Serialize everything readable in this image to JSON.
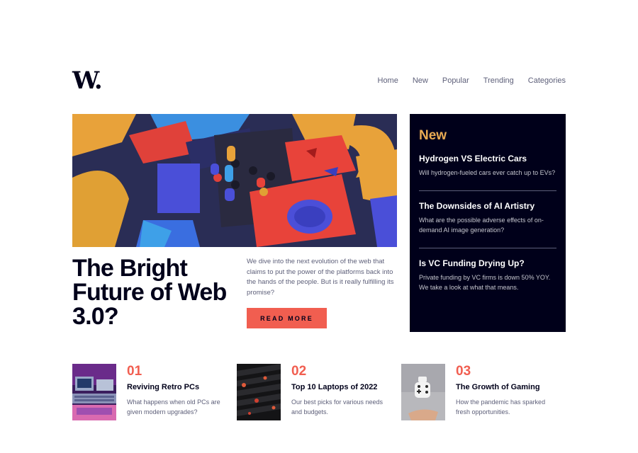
{
  "logo": "W.",
  "nav": [
    "Home",
    "New",
    "Popular",
    "Trending",
    "Categories"
  ],
  "hero": {
    "title": "The Bright Future of Web 3.0?",
    "text": "We dive into the next evolution of the web that claims to put the power of the platforms back into the hands of the people. But is it really fulfilling its promise?",
    "button": "READ MORE"
  },
  "new_section": {
    "heading": "New",
    "items": [
      {
        "title": "Hydrogen VS Electric Cars",
        "text": "Will hydrogen-fueled cars ever catch up to EVs?"
      },
      {
        "title": "The Downsides of AI Artistry",
        "text": "What are the possible adverse effects of on-demand AI image generation?"
      },
      {
        "title": "Is VC Funding Drying Up?",
        "text": "Private funding by VC firms is down 50% YOY. We take a look at what that means."
      }
    ]
  },
  "articles": [
    {
      "num": "01",
      "title": "Reviving Retro PCs",
      "text": "What happens when old PCs are given modern upgrades?"
    },
    {
      "num": "02",
      "title": "Top 10 Laptops of 2022",
      "text": "Our best picks for various needs and budgets."
    },
    {
      "num": "03",
      "title": "The Growth of Gaming",
      "text": "How the pandemic has sparked fresh opportunities."
    }
  ],
  "colors": {
    "accent": "#f15e50",
    "gold": "#e9ab53",
    "navy": "#00001a",
    "gray": "#5d5f79"
  }
}
